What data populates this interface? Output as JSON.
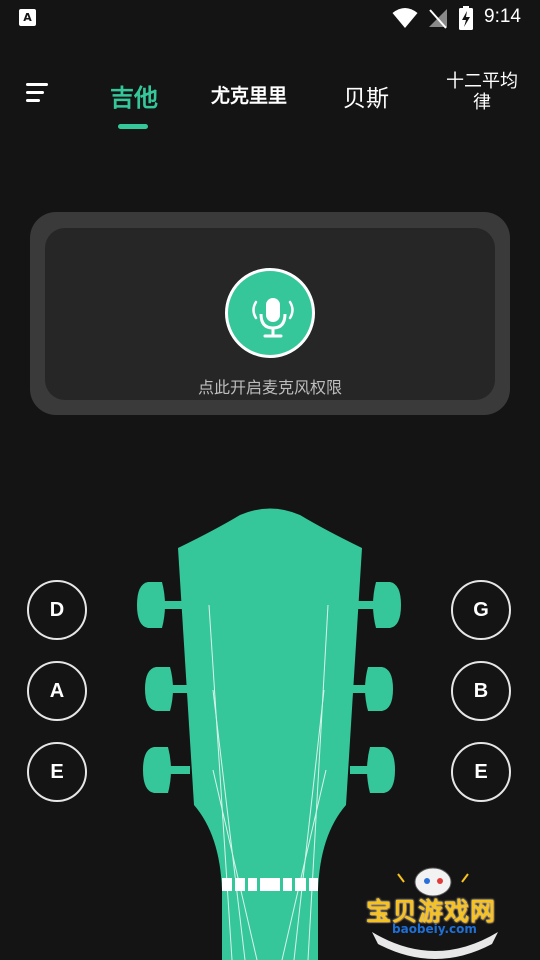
{
  "status_bar": {
    "left_icon": "A",
    "time": "9:14",
    "icons": [
      "wifi-icon",
      "signal-off-icon",
      "battery-charging-icon"
    ]
  },
  "nav": {
    "menu_icon": "menu-icon",
    "tabs": [
      {
        "label": "吉他",
        "active": true
      },
      {
        "label": "尤克里里",
        "active": false
      },
      {
        "label": "贝斯",
        "active": false
      },
      {
        "label": "十二平均律",
        "active": false
      }
    ],
    "accent_color": "#35c79a"
  },
  "mic_panel": {
    "icon": "microphone-icon",
    "label": "点此开启麦克风权限"
  },
  "strings": {
    "left": [
      "D",
      "A",
      "E"
    ],
    "right": [
      "G",
      "B",
      "E"
    ]
  },
  "instrument": {
    "name": "guitar-headstock",
    "color": "#35c79a"
  },
  "watermark": {
    "title": "宝贝游戏网",
    "url": "baobeiy.com"
  }
}
